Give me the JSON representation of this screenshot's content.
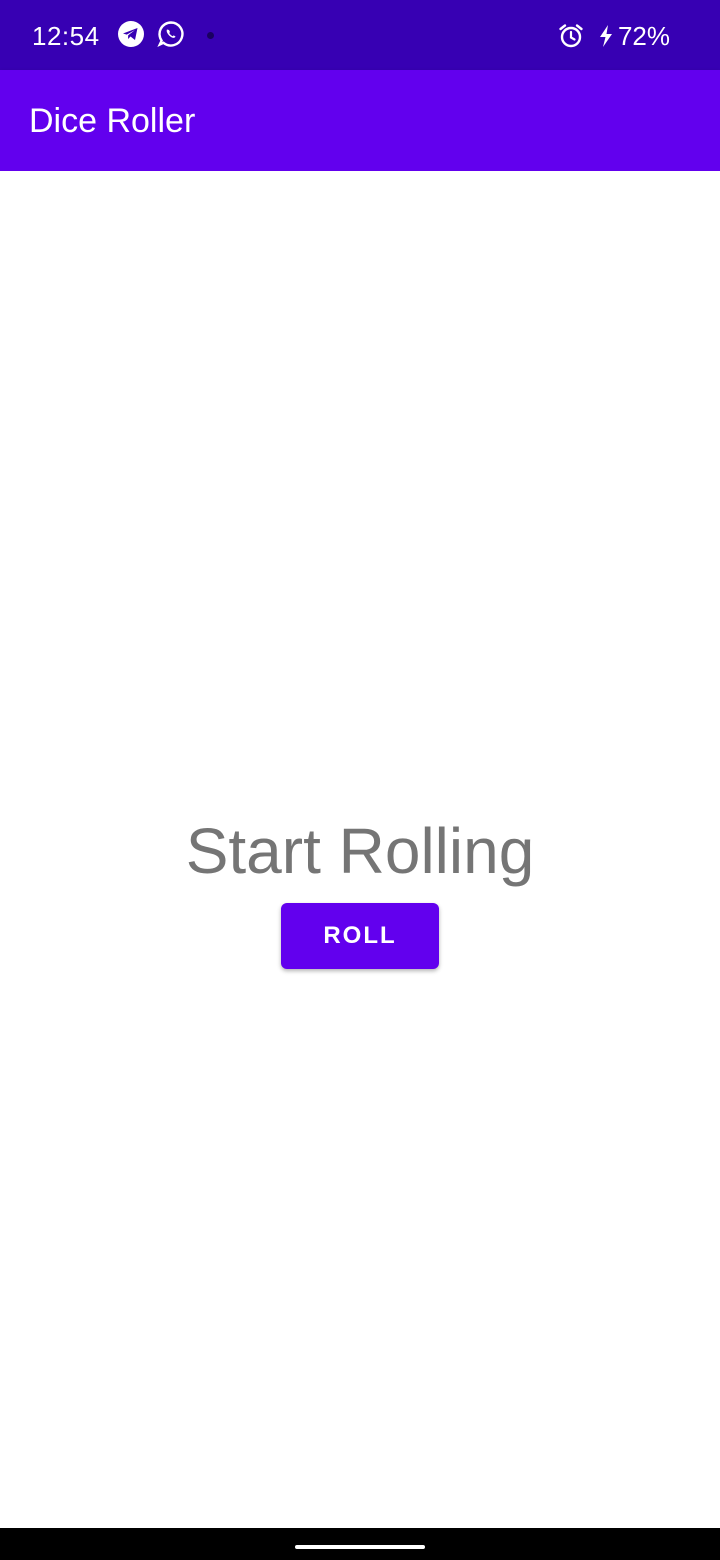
{
  "status_bar": {
    "time": "12:54",
    "battery": "72%",
    "icons": [
      "telegram-icon",
      "whatsapp-icon",
      "notification-dot-icon",
      "alarm-icon",
      "charging-bolt-icon"
    ]
  },
  "app_bar": {
    "title": "Dice Roller"
  },
  "main": {
    "result_text": "Start Rolling",
    "roll_button_label": "ROLL"
  },
  "colors": {
    "status_bar": "#3700b3",
    "primary": "#6200ee",
    "result_text": "#757575",
    "background": "#ffffff"
  }
}
